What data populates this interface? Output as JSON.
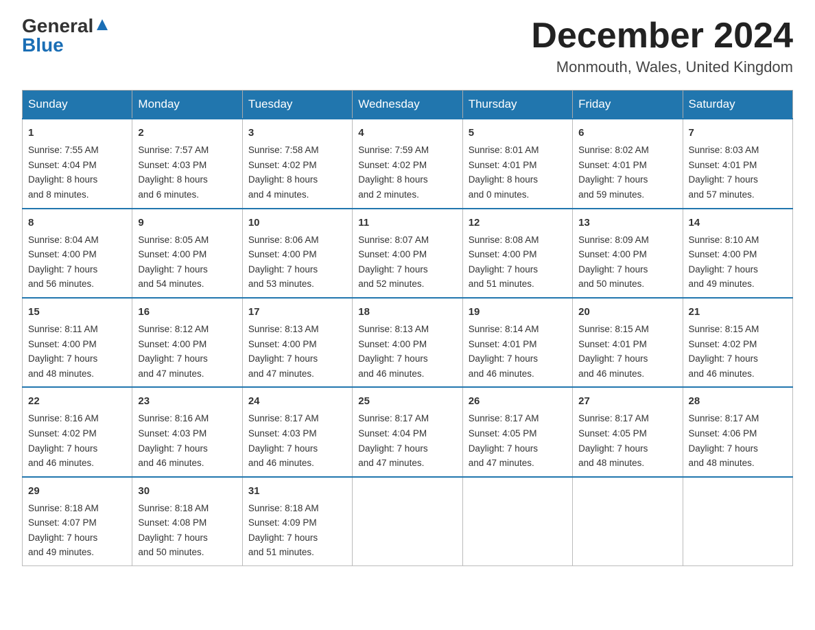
{
  "logo": {
    "general": "General",
    "blue": "Blue"
  },
  "title": {
    "month": "December 2024",
    "location": "Monmouth, Wales, United Kingdom"
  },
  "headers": [
    "Sunday",
    "Monday",
    "Tuesday",
    "Wednesday",
    "Thursday",
    "Friday",
    "Saturday"
  ],
  "weeks": [
    [
      {
        "day": "1",
        "info": "Sunrise: 7:55 AM\nSunset: 4:04 PM\nDaylight: 8 hours\nand 8 minutes."
      },
      {
        "day": "2",
        "info": "Sunrise: 7:57 AM\nSunset: 4:03 PM\nDaylight: 8 hours\nand 6 minutes."
      },
      {
        "day": "3",
        "info": "Sunrise: 7:58 AM\nSunset: 4:02 PM\nDaylight: 8 hours\nand 4 minutes."
      },
      {
        "day": "4",
        "info": "Sunrise: 7:59 AM\nSunset: 4:02 PM\nDaylight: 8 hours\nand 2 minutes."
      },
      {
        "day": "5",
        "info": "Sunrise: 8:01 AM\nSunset: 4:01 PM\nDaylight: 8 hours\nand 0 minutes."
      },
      {
        "day": "6",
        "info": "Sunrise: 8:02 AM\nSunset: 4:01 PM\nDaylight: 7 hours\nand 59 minutes."
      },
      {
        "day": "7",
        "info": "Sunrise: 8:03 AM\nSunset: 4:01 PM\nDaylight: 7 hours\nand 57 minutes."
      }
    ],
    [
      {
        "day": "8",
        "info": "Sunrise: 8:04 AM\nSunset: 4:00 PM\nDaylight: 7 hours\nand 56 minutes."
      },
      {
        "day": "9",
        "info": "Sunrise: 8:05 AM\nSunset: 4:00 PM\nDaylight: 7 hours\nand 54 minutes."
      },
      {
        "day": "10",
        "info": "Sunrise: 8:06 AM\nSunset: 4:00 PM\nDaylight: 7 hours\nand 53 minutes."
      },
      {
        "day": "11",
        "info": "Sunrise: 8:07 AM\nSunset: 4:00 PM\nDaylight: 7 hours\nand 52 minutes."
      },
      {
        "day": "12",
        "info": "Sunrise: 8:08 AM\nSunset: 4:00 PM\nDaylight: 7 hours\nand 51 minutes."
      },
      {
        "day": "13",
        "info": "Sunrise: 8:09 AM\nSunset: 4:00 PM\nDaylight: 7 hours\nand 50 minutes."
      },
      {
        "day": "14",
        "info": "Sunrise: 8:10 AM\nSunset: 4:00 PM\nDaylight: 7 hours\nand 49 minutes."
      }
    ],
    [
      {
        "day": "15",
        "info": "Sunrise: 8:11 AM\nSunset: 4:00 PM\nDaylight: 7 hours\nand 48 minutes."
      },
      {
        "day": "16",
        "info": "Sunrise: 8:12 AM\nSunset: 4:00 PM\nDaylight: 7 hours\nand 47 minutes."
      },
      {
        "day": "17",
        "info": "Sunrise: 8:13 AM\nSunset: 4:00 PM\nDaylight: 7 hours\nand 47 minutes."
      },
      {
        "day": "18",
        "info": "Sunrise: 8:13 AM\nSunset: 4:00 PM\nDaylight: 7 hours\nand 46 minutes."
      },
      {
        "day": "19",
        "info": "Sunrise: 8:14 AM\nSunset: 4:01 PM\nDaylight: 7 hours\nand 46 minutes."
      },
      {
        "day": "20",
        "info": "Sunrise: 8:15 AM\nSunset: 4:01 PM\nDaylight: 7 hours\nand 46 minutes."
      },
      {
        "day": "21",
        "info": "Sunrise: 8:15 AM\nSunset: 4:02 PM\nDaylight: 7 hours\nand 46 minutes."
      }
    ],
    [
      {
        "day": "22",
        "info": "Sunrise: 8:16 AM\nSunset: 4:02 PM\nDaylight: 7 hours\nand 46 minutes."
      },
      {
        "day": "23",
        "info": "Sunrise: 8:16 AM\nSunset: 4:03 PM\nDaylight: 7 hours\nand 46 minutes."
      },
      {
        "day": "24",
        "info": "Sunrise: 8:17 AM\nSunset: 4:03 PM\nDaylight: 7 hours\nand 46 minutes."
      },
      {
        "day": "25",
        "info": "Sunrise: 8:17 AM\nSunset: 4:04 PM\nDaylight: 7 hours\nand 47 minutes."
      },
      {
        "day": "26",
        "info": "Sunrise: 8:17 AM\nSunset: 4:05 PM\nDaylight: 7 hours\nand 47 minutes."
      },
      {
        "day": "27",
        "info": "Sunrise: 8:17 AM\nSunset: 4:05 PM\nDaylight: 7 hours\nand 48 minutes."
      },
      {
        "day": "28",
        "info": "Sunrise: 8:17 AM\nSunset: 4:06 PM\nDaylight: 7 hours\nand 48 minutes."
      }
    ],
    [
      {
        "day": "29",
        "info": "Sunrise: 8:18 AM\nSunset: 4:07 PM\nDaylight: 7 hours\nand 49 minutes."
      },
      {
        "day": "30",
        "info": "Sunrise: 8:18 AM\nSunset: 4:08 PM\nDaylight: 7 hours\nand 50 minutes."
      },
      {
        "day": "31",
        "info": "Sunrise: 8:18 AM\nSunset: 4:09 PM\nDaylight: 7 hours\nand 51 minutes."
      },
      null,
      null,
      null,
      null
    ]
  ]
}
